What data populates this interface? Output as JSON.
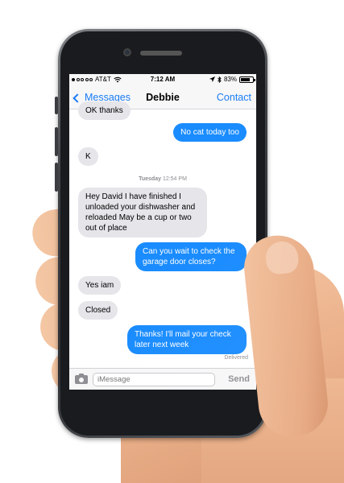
{
  "status_bar": {
    "signal_dots_filled": 1,
    "signal_dots_total": 5,
    "carrier": "AT&T",
    "time": "7:12 AM",
    "battery_text": "83%",
    "battery_level": 0.83
  },
  "nav": {
    "back_label": "Messages",
    "title": "Debbie",
    "contact_label": "Contact"
  },
  "messages": [
    {
      "direction": "in",
      "text": "OK thanks"
    },
    {
      "direction": "out",
      "text": "No cat today too"
    },
    {
      "direction": "in",
      "text": "K"
    },
    {
      "direction": "in",
      "text": "Hey David I have finished I unloaded your dishwasher and reloaded May be a cup or two out of place"
    },
    {
      "direction": "out",
      "text": "Can you wait to check the garage door closes?"
    },
    {
      "direction": "in",
      "text": "Yes iam"
    },
    {
      "direction": "in",
      "text": "Closed"
    },
    {
      "direction": "out",
      "text": "Thanks! I'll mail your check later next week"
    }
  ],
  "timestamp": {
    "day": "Tuesday",
    "time": "12:54 PM"
  },
  "delivered_label": "Delivered",
  "composer": {
    "placeholder": "iMessage",
    "send_label": "Send"
  },
  "colors": {
    "ios_blue": "#1a7cf5",
    "outgoing_bubble": "#1a8cff",
    "incoming_bubble": "#e5e5ea"
  }
}
